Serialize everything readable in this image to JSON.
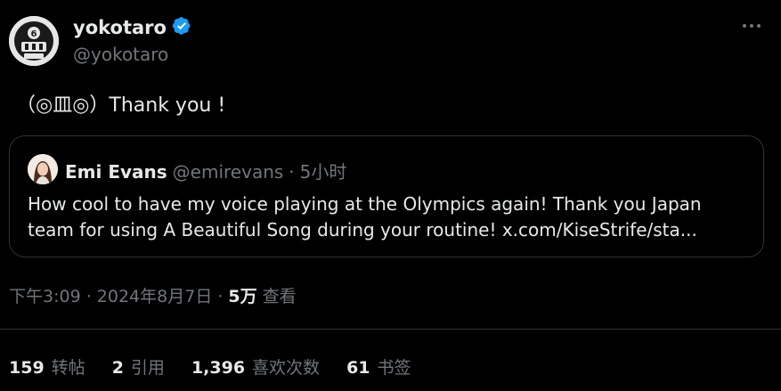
{
  "tweet": {
    "display_name": "yokotaro",
    "handle": "@yokotaro",
    "text": "（◎皿◎）Thank you !",
    "verified_icon": "verified-badge-icon",
    "more_icon": "more-horizontal-icon"
  },
  "quote": {
    "display_name": "Emi Evans",
    "handle": "@emirevans",
    "separator": "·",
    "time": "5小时",
    "text": "How cool to have my voice playing at the Olympics again! Thank you Japan team for using A Beautiful Song during your routine! x.com/KiseStrife/sta..."
  },
  "meta": {
    "timestamp": "下午3:09 · 2024年8月7日",
    "separator": "·",
    "views_count": "5万",
    "views_label": "查看"
  },
  "stats": {
    "retweets": {
      "count": "159",
      "label": "转帖"
    },
    "quotes": {
      "count": "2",
      "label": "引用"
    },
    "likes": {
      "count": "1,396",
      "label": "喜欢次数"
    },
    "bookmarks": {
      "count": "61",
      "label": "书签"
    }
  },
  "colors": {
    "background": "#000000",
    "text": "#e7e9ea",
    "secondary_text": "#71767b",
    "border": "#2f3336",
    "verified": "#1d9bf0"
  }
}
